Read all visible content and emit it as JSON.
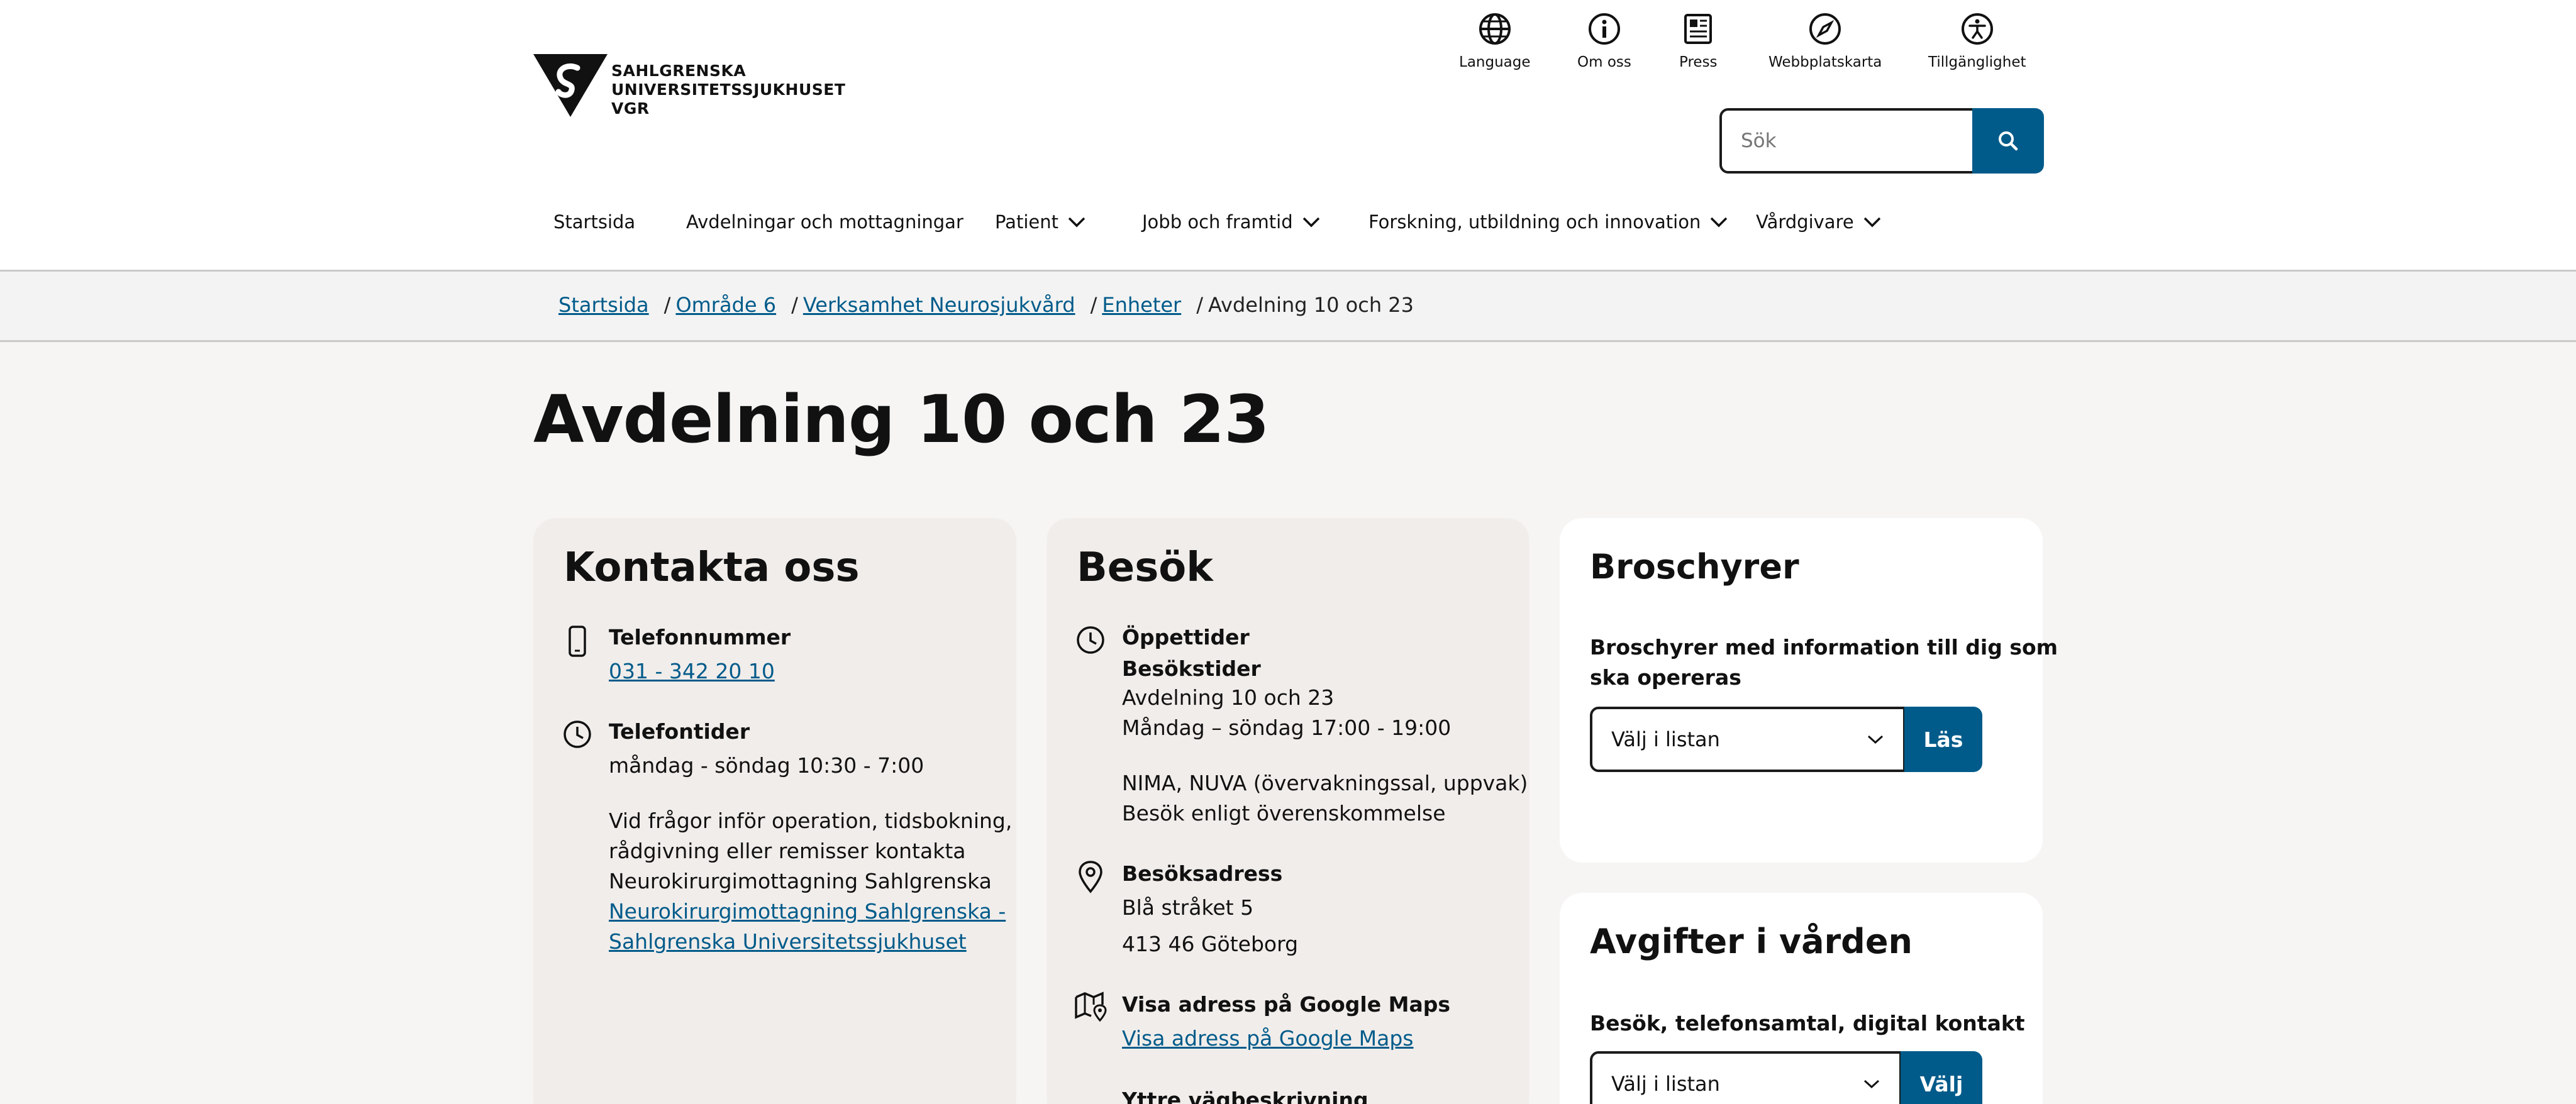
{
  "logo": {
    "line1": "SAHLGRENSKA",
    "line2": "UNIVERSITETSSJUKHUSET",
    "line3": "VGR"
  },
  "utility_nav": [
    {
      "label": "Language",
      "icon": "globe-icon"
    },
    {
      "label": "Om oss",
      "icon": "info-icon"
    },
    {
      "label": "Press",
      "icon": "newspaper-icon"
    },
    {
      "label": "Webbplatskarta",
      "icon": "compass-icon"
    },
    {
      "label": "Tillgänglighet",
      "icon": "accessibility-icon"
    }
  ],
  "search": {
    "placeholder": "Sök"
  },
  "main_nav": [
    {
      "label": "Startsida"
    },
    {
      "label": "Avdelningar och mottagningar"
    },
    {
      "label": "Patient"
    },
    {
      "label": "Jobb och framtid"
    },
    {
      "label": "Forskning, utbildning och innovation"
    },
    {
      "label": "Vårdgivare"
    }
  ],
  "breadcrumb": {
    "items": [
      "Startsida",
      "Område 6",
      "Verksamhet Neurosjukvård",
      "Enheter"
    ],
    "separator": "/",
    "current": "Avdelning 10 och 23"
  },
  "page_title": "Avdelning 10 och 23",
  "contact": {
    "title": "Kontakta oss",
    "phone_label": "Telefonnummer",
    "phone_value": "031 - 342 20 10",
    "hours_label": "Telefontider",
    "hours_value": "måndag - söndag 10:30 - 7:00",
    "info_lines": [
      "Vid frågor inför operation, tidsbokning,",
      "rådgivning eller remisser kontakta",
      "Neurokirurgimottagning Sahlgrenska"
    ],
    "info_link_lines": [
      " Neurokirurgimottagning Sahlgrenska -",
      "Sahlgrenska Universitetssjukhuset"
    ]
  },
  "visit": {
    "title": "Besök",
    "hours_label": "Öppettider",
    "visiting_label": "Besökstider",
    "visiting_lines": [
      "Avdelning 10 och 23",
      "Måndag – söndag 17:00 - 19:00"
    ],
    "nima_lines": [
      "NIMA, NUVA (övervakningssal, uppvak)",
      "Besök enligt överenskommelse"
    ],
    "address_label": "Besöksadress",
    "address_lines": [
      "Blå stråket 5",
      "413 46 Göteborg"
    ],
    "maps_label": "Visa adress på Google Maps",
    "maps_link": "Visa adress på Google Maps",
    "directions_label": "Yttre vägbeskrivning"
  },
  "brochures": {
    "title": "Broschyrer",
    "desc_lines": [
      "Broschyrer med information till dig som",
      "ska opereras"
    ],
    "select_value": "Välj i listan",
    "button": "Läs"
  },
  "fees": {
    "title": "Avgifter i vården",
    "desc": "Besök, telefonsamtal, digital kontakt",
    "select_value": "Välj i listan",
    "button": "Välj"
  }
}
